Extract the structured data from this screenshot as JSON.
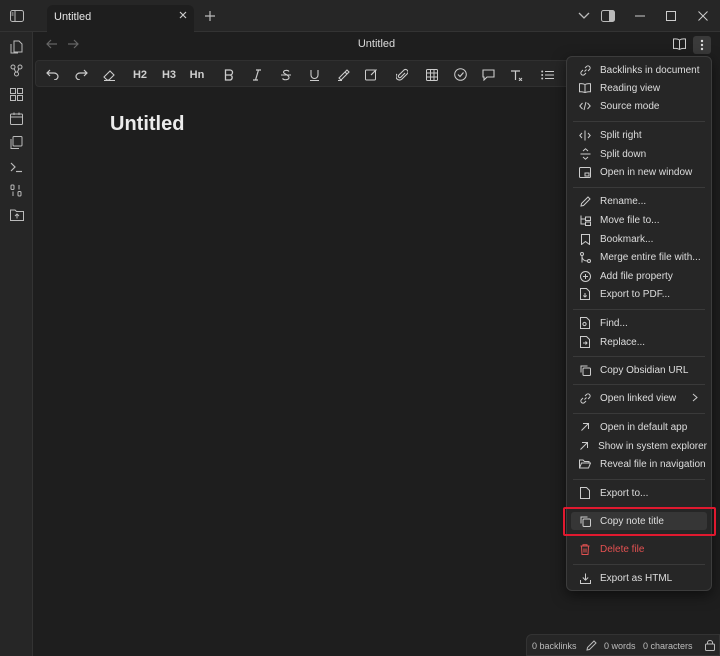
{
  "tab": {
    "title": "Untitled"
  },
  "view": {
    "title": "Untitled"
  },
  "note": {
    "title": "Untitled"
  },
  "toolbar": {
    "h2": "H2",
    "h3": "H3",
    "hn": "Hn"
  },
  "menu": {
    "items": [
      {
        "label": "Backlinks in document",
        "icon": "backlinks-icon"
      },
      {
        "label": "Reading view",
        "icon": "book-open-icon"
      },
      {
        "label": "Source mode",
        "icon": "code-icon"
      },
      {
        "label": "Split right",
        "icon": "split-right-icon"
      },
      {
        "label": "Split down",
        "icon": "split-down-icon"
      },
      {
        "label": "Open in new window",
        "icon": "new-window-icon"
      },
      {
        "label": "Rename...",
        "icon": "pencil-icon"
      },
      {
        "label": "Move file to...",
        "icon": "folder-tree-icon"
      },
      {
        "label": "Bookmark...",
        "icon": "bookmark-icon"
      },
      {
        "label": "Merge entire file with...",
        "icon": "git-merge-icon"
      },
      {
        "label": "Add file property",
        "icon": "plus-circle-icon"
      },
      {
        "label": "Export to PDF...",
        "icon": "file-down-icon"
      },
      {
        "label": "Find...",
        "icon": "file-search-icon"
      },
      {
        "label": "Replace...",
        "icon": "file-replace-icon"
      },
      {
        "label": "Copy Obsidian URL",
        "icon": "copy-icon"
      },
      {
        "label": "Open linked view",
        "icon": "link-icon"
      },
      {
        "label": "Open in default app",
        "icon": "arrow-up-right-icon"
      },
      {
        "label": "Show in system explorer",
        "icon": "arrow-up-right-icon"
      },
      {
        "label": "Reveal file in navigation",
        "icon": "folder-open-icon"
      },
      {
        "label": "Export to...",
        "icon": "file-icon"
      },
      {
        "label": "Copy note title",
        "icon": "copy-icon"
      },
      {
        "label": "Delete file",
        "icon": "trash-icon"
      },
      {
        "label": "Export as HTML",
        "icon": "download-icon"
      }
    ]
  },
  "status": {
    "backlinks": "0 backlinks",
    "words": "0 words",
    "characters": "0 characters"
  },
  "colors": {
    "highlight_border": "#e0192f",
    "danger": "#e35151"
  }
}
